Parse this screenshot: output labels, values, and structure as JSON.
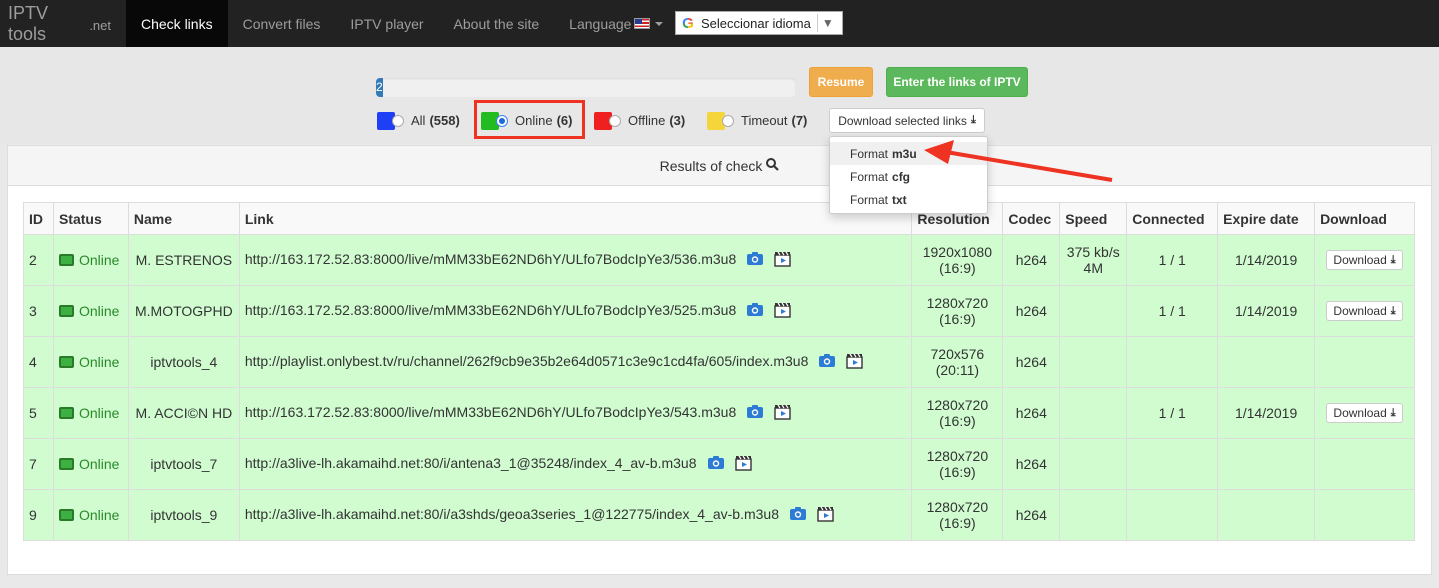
{
  "navbar": {
    "brand_main": "IPTV tools",
    "brand_suffix": ".net",
    "items": [
      {
        "label": "Check links",
        "active": true
      },
      {
        "label": "Convert files"
      },
      {
        "label": "IPTV player"
      },
      {
        "label": "About the site"
      },
      {
        "label": "Language"
      }
    ],
    "translate_select": "Seleccionar idioma"
  },
  "controls": {
    "progress_value": "2",
    "resume_label": "Resume",
    "enter_label": "Enter the links of IPTV",
    "filters": [
      {
        "label": "All",
        "count": "(558)",
        "color": "#1f3ff7",
        "checked": false
      },
      {
        "label": "Online",
        "count": "(6)",
        "color": "#22bb22",
        "checked": true
      },
      {
        "label": "Offline",
        "count": "(3)",
        "color": "#f02020",
        "checked": false
      },
      {
        "label": "Timeout",
        "count": "(7)",
        "color": "#f5d63a",
        "checked": false
      }
    ],
    "download_selected_label": "Download selected links"
  },
  "dropdown": {
    "items": [
      {
        "prefix": "Format",
        "format": "m3u"
      },
      {
        "prefix": "Format",
        "format": "cfg"
      },
      {
        "prefix": "Format",
        "format": "txt"
      }
    ]
  },
  "results": {
    "heading": "Results of check",
    "columns": [
      "ID",
      "Status",
      "Name",
      "Link",
      "Resolution",
      "Codec",
      "Speed",
      "Connected",
      "Expire date",
      "Download"
    ],
    "rows": [
      {
        "id": "2",
        "status": "Online",
        "name": "M. ESTRENOS",
        "link": "http://163.172.52.83:8000/live/mMM33bE62ND6hY/ULfo7BodcIpYe3/536.m3u8",
        "res1": "1920x1080",
        "res2": "(16:9)",
        "codec": "h264",
        "speed1": "375 kb/s",
        "speed2": "4M",
        "connected": "1 / 1",
        "expire": "1/14/2019",
        "download": "Download"
      },
      {
        "id": "3",
        "status": "Online",
        "name": "M.MOTOGPHD",
        "link": "http://163.172.52.83:8000/live/mMM33bE62ND6hY/ULfo7BodcIpYe3/525.m3u8",
        "res1": "1280x720",
        "res2": "(16:9)",
        "codec": "h264",
        "speed1": "",
        "speed2": "",
        "connected": "1 / 1",
        "expire": "1/14/2019",
        "download": "Download"
      },
      {
        "id": "4",
        "status": "Online",
        "name": "iptvtools_4",
        "link": "http://playlist.onlybest.tv/ru/channel/262f9cb9e35b2e64d0571c3e9c1cd4fa/605/index.m3u8",
        "res1": "720x576",
        "res2": "(20:11)",
        "codec": "h264",
        "speed1": "",
        "speed2": "",
        "connected": "",
        "expire": "",
        "download": ""
      },
      {
        "id": "5",
        "status": "Online",
        "name": "M. ACCI©N HD",
        "link": "http://163.172.52.83:8000/live/mMM33bE62ND6hY/ULfo7BodcIpYe3/543.m3u8",
        "res1": "1280x720",
        "res2": "(16:9)",
        "codec": "h264",
        "speed1": "",
        "speed2": "",
        "connected": "1 / 1",
        "expire": "1/14/2019",
        "download": "Download"
      },
      {
        "id": "7",
        "status": "Online",
        "name": "iptvtools_7",
        "link": "http://a3live-lh.akamaihd.net:80/i/antena3_1@35248/index_4_av-b.m3u8",
        "res1": "1280x720",
        "res2": "(16:9)",
        "codec": "h264",
        "speed1": "",
        "speed2": "",
        "connected": "",
        "expire": "",
        "download": ""
      },
      {
        "id": "9",
        "status": "Online",
        "name": "iptvtools_9",
        "link": "http://a3live-lh.akamaihd.net:80/i/a3shds/geoa3series_1@122775/index_4_av-b.m3u8",
        "res1": "1280x720",
        "res2": "(16:9)",
        "codec": "h264",
        "speed1": "",
        "speed2": "",
        "connected": "",
        "expire": "",
        "download": ""
      }
    ]
  }
}
